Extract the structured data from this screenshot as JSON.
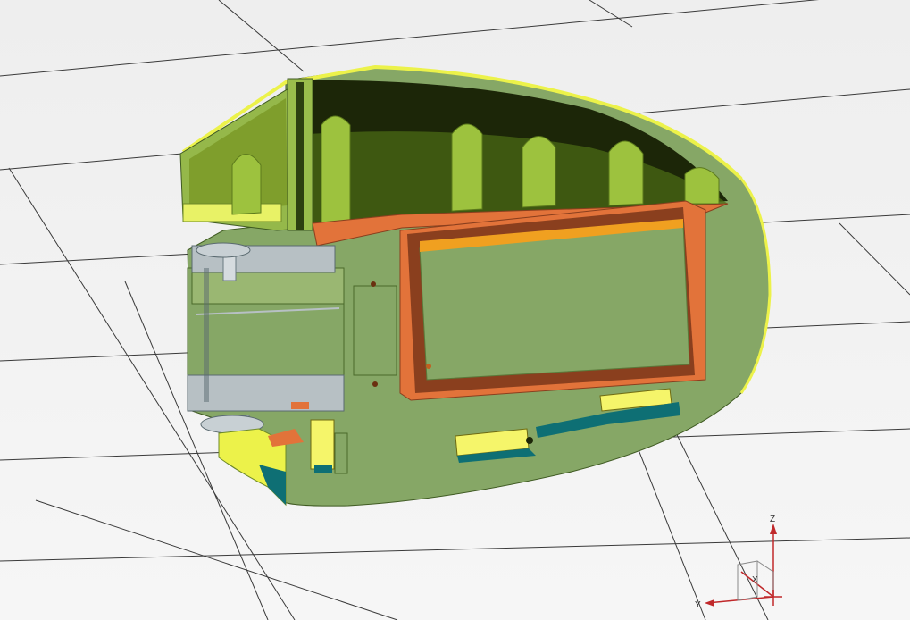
{
  "viewport": {
    "background": "#f2f2f2",
    "grid_color": "#3a3a3a"
  },
  "model": {
    "colors": {
      "shell_section": "#86a766",
      "shell_inner": "#95b84a",
      "shell_dark": "#1c2608",
      "edge_highlight": "#ecf24a",
      "copper": "#e2733a",
      "copper_dark": "#8a3f1e",
      "board_face": "#86a766",
      "board_edge": "#f0a020",
      "yellow": "#f5f56a",
      "teal": "#0e6f74",
      "metal": "#b7c0c4"
    }
  },
  "triad": {
    "z_label": "Z",
    "y_label": "Y",
    "x_label": "X",
    "axis_color": "#c0282a"
  }
}
